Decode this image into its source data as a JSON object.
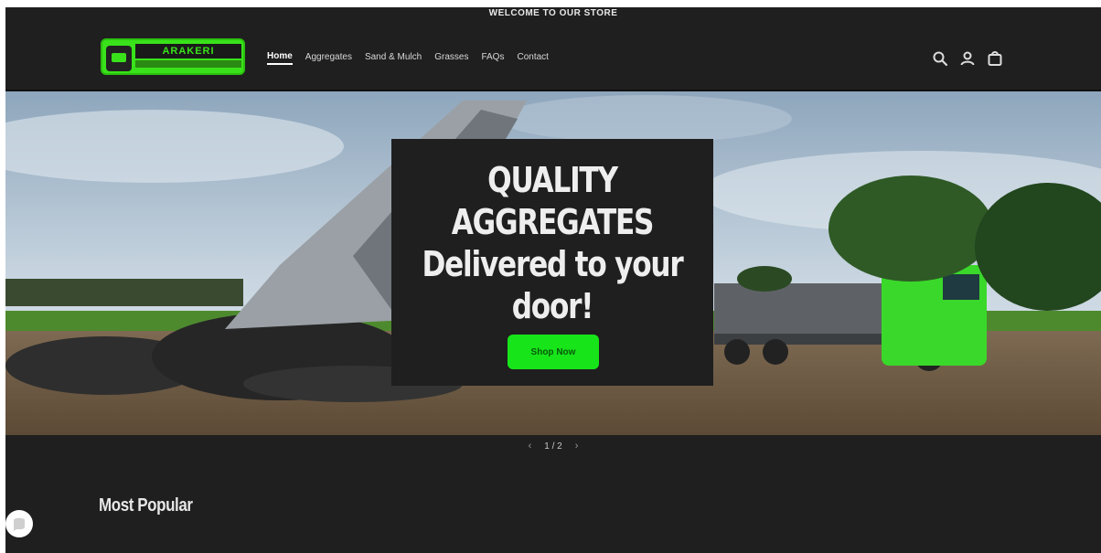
{
  "announcement": {
    "text": "WELCOME TO OUR STORE"
  },
  "brand": {
    "name": "ARAKERI"
  },
  "nav": {
    "items": [
      {
        "label": "Home",
        "active": true
      },
      {
        "label": "Aggregates",
        "active": false
      },
      {
        "label": "Sand & Mulch",
        "active": false
      },
      {
        "label": "Grasses",
        "active": false
      },
      {
        "label": "FAQs",
        "active": false
      },
      {
        "label": "Contact",
        "active": false
      }
    ]
  },
  "header_icons": [
    "search-icon",
    "account-icon",
    "cart-icon"
  ],
  "hero": {
    "line1": "QUALITY",
    "line2": "AGGREGATES",
    "line3": "Delivered to your",
    "line4": "door!",
    "button_label": "Shop Now"
  },
  "slider": {
    "prev": "‹",
    "count": "1 / 2",
    "next": "›"
  },
  "section": {
    "title": "Most Popular"
  },
  "colors": {
    "accent": "#17e51a",
    "background": "#1f1f1f",
    "truck": "#3ad82a"
  }
}
